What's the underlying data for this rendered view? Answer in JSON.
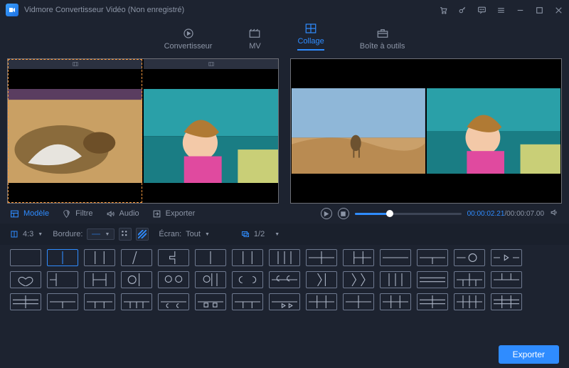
{
  "window": {
    "title": "Vidmore Convertisseur Vidéo (Non enregistré)"
  },
  "nav": {
    "convertisseur": "Convertisseur",
    "mv": "MV",
    "collage": "Collage",
    "boite": "Boîte à outils"
  },
  "tabs": {
    "modele": "Modèle",
    "filtre": "Filtre",
    "audio": "Audio",
    "exporter": "Exporter"
  },
  "player": {
    "current": "00:00:02.21",
    "total": "00:00:07.00"
  },
  "options": {
    "ratio": "4:3",
    "bordure_label": "Bordure:",
    "ecran_label": "Écran:",
    "ecran_value": "Tout",
    "page": "1/2"
  },
  "footer": {
    "export": "Exporter"
  }
}
